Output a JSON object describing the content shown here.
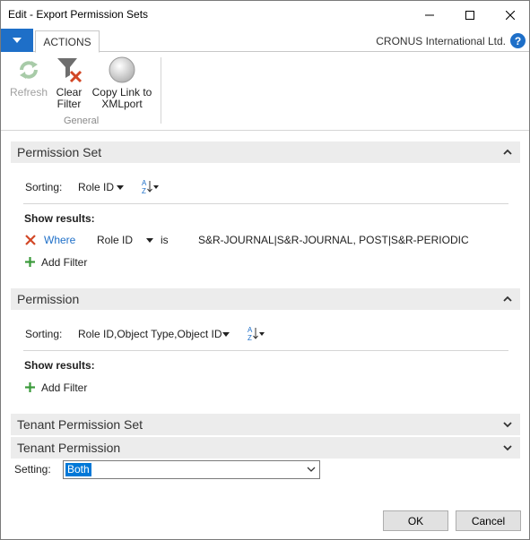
{
  "window": {
    "title": "Edit - Export Permission Sets"
  },
  "ribbon": {
    "tab_actions": "ACTIONS",
    "company": "CRONUS International Ltd.",
    "help": "?",
    "buttons": {
      "refresh": "Refresh",
      "clear_filter_line1": "Clear",
      "clear_filter_line2": "Filter",
      "copy_link_line1": "Copy Link to",
      "copy_link_line2": "XMLport"
    },
    "group_label": "General"
  },
  "permission_set": {
    "header": "Permission Set",
    "sorting_label": "Sorting:",
    "sorting_value": "Role ID",
    "show_results": "Show results:",
    "filter_where": "Where",
    "filter_field": "Role ID",
    "filter_op": "is",
    "filter_value": "S&R-JOURNAL|S&R-JOURNAL, POST|S&R-PERIODIC",
    "add_filter": "Add Filter"
  },
  "permission": {
    "header": "Permission",
    "sorting_label": "Sorting:",
    "sorting_value": "Role ID,Object Type,Object ID",
    "show_results": "Show results:",
    "add_filter": "Add Filter"
  },
  "tenant_permission_set": {
    "header": "Tenant Permission Set"
  },
  "tenant_permission": {
    "header": "Tenant Permission"
  },
  "setting": {
    "label": "Setting:",
    "value": "Both"
  },
  "footer": {
    "ok": "OK",
    "cancel": "Cancel"
  },
  "colors": {
    "accent": "#1e6fc8",
    "remove_filter": "#d24726",
    "add_filter": "#3a9a3a",
    "section_bg": "#ececec"
  }
}
